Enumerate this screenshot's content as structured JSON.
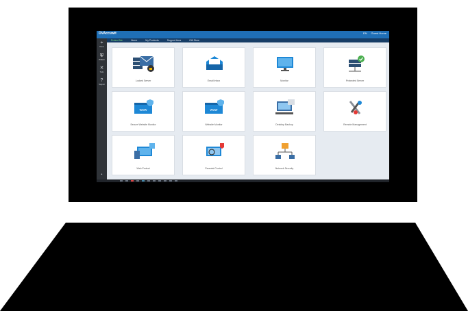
{
  "app": {
    "brand": "DVAccuwit",
    "topbar_right": [
      "EN",
      "Guest Home"
    ]
  },
  "nav": {
    "items": [
      "Protect Me",
      "Home",
      "My Products",
      "Support Area",
      "Gift Store"
    ]
  },
  "sidebar": {
    "items": [
      {
        "icon": "router-icon",
        "label": "Home"
      },
      {
        "icon": "shield-icon",
        "label": "Protect"
      },
      {
        "icon": "tools-icon",
        "label": "Tools"
      },
      {
        "icon": "help-icon",
        "label": "Support"
      }
    ]
  },
  "tiles": [
    {
      "name": "tile-1",
      "caption": "Locked Server",
      "art": "server-lock"
    },
    {
      "name": "tile-2",
      "caption": "Email Inbox",
      "art": "mail-tray"
    },
    {
      "name": "tile-3",
      "caption": "Monitor",
      "art": "monitor"
    },
    {
      "name": "tile-4",
      "caption": "Protected Server",
      "art": "server-check"
    },
    {
      "name": "tile-5",
      "caption": "Secure Website Monitor",
      "art": "www-shield"
    },
    {
      "name": "tile-6",
      "caption": "Website Monitor",
      "art": "www-shield-2"
    },
    {
      "name": "tile-7",
      "caption": "Desktop Backup",
      "art": "desktop-backup"
    },
    {
      "name": "tile-8",
      "caption": "Remote Management",
      "art": "tools-remote"
    },
    {
      "name": "tile-9",
      "caption": "Web Protect",
      "art": "device-protect"
    },
    {
      "name": "tile-10",
      "caption": "Parental Control",
      "art": "search-alert"
    },
    {
      "name": "tile-11",
      "caption": "Network Security",
      "art": "network-tree"
    }
  ]
}
